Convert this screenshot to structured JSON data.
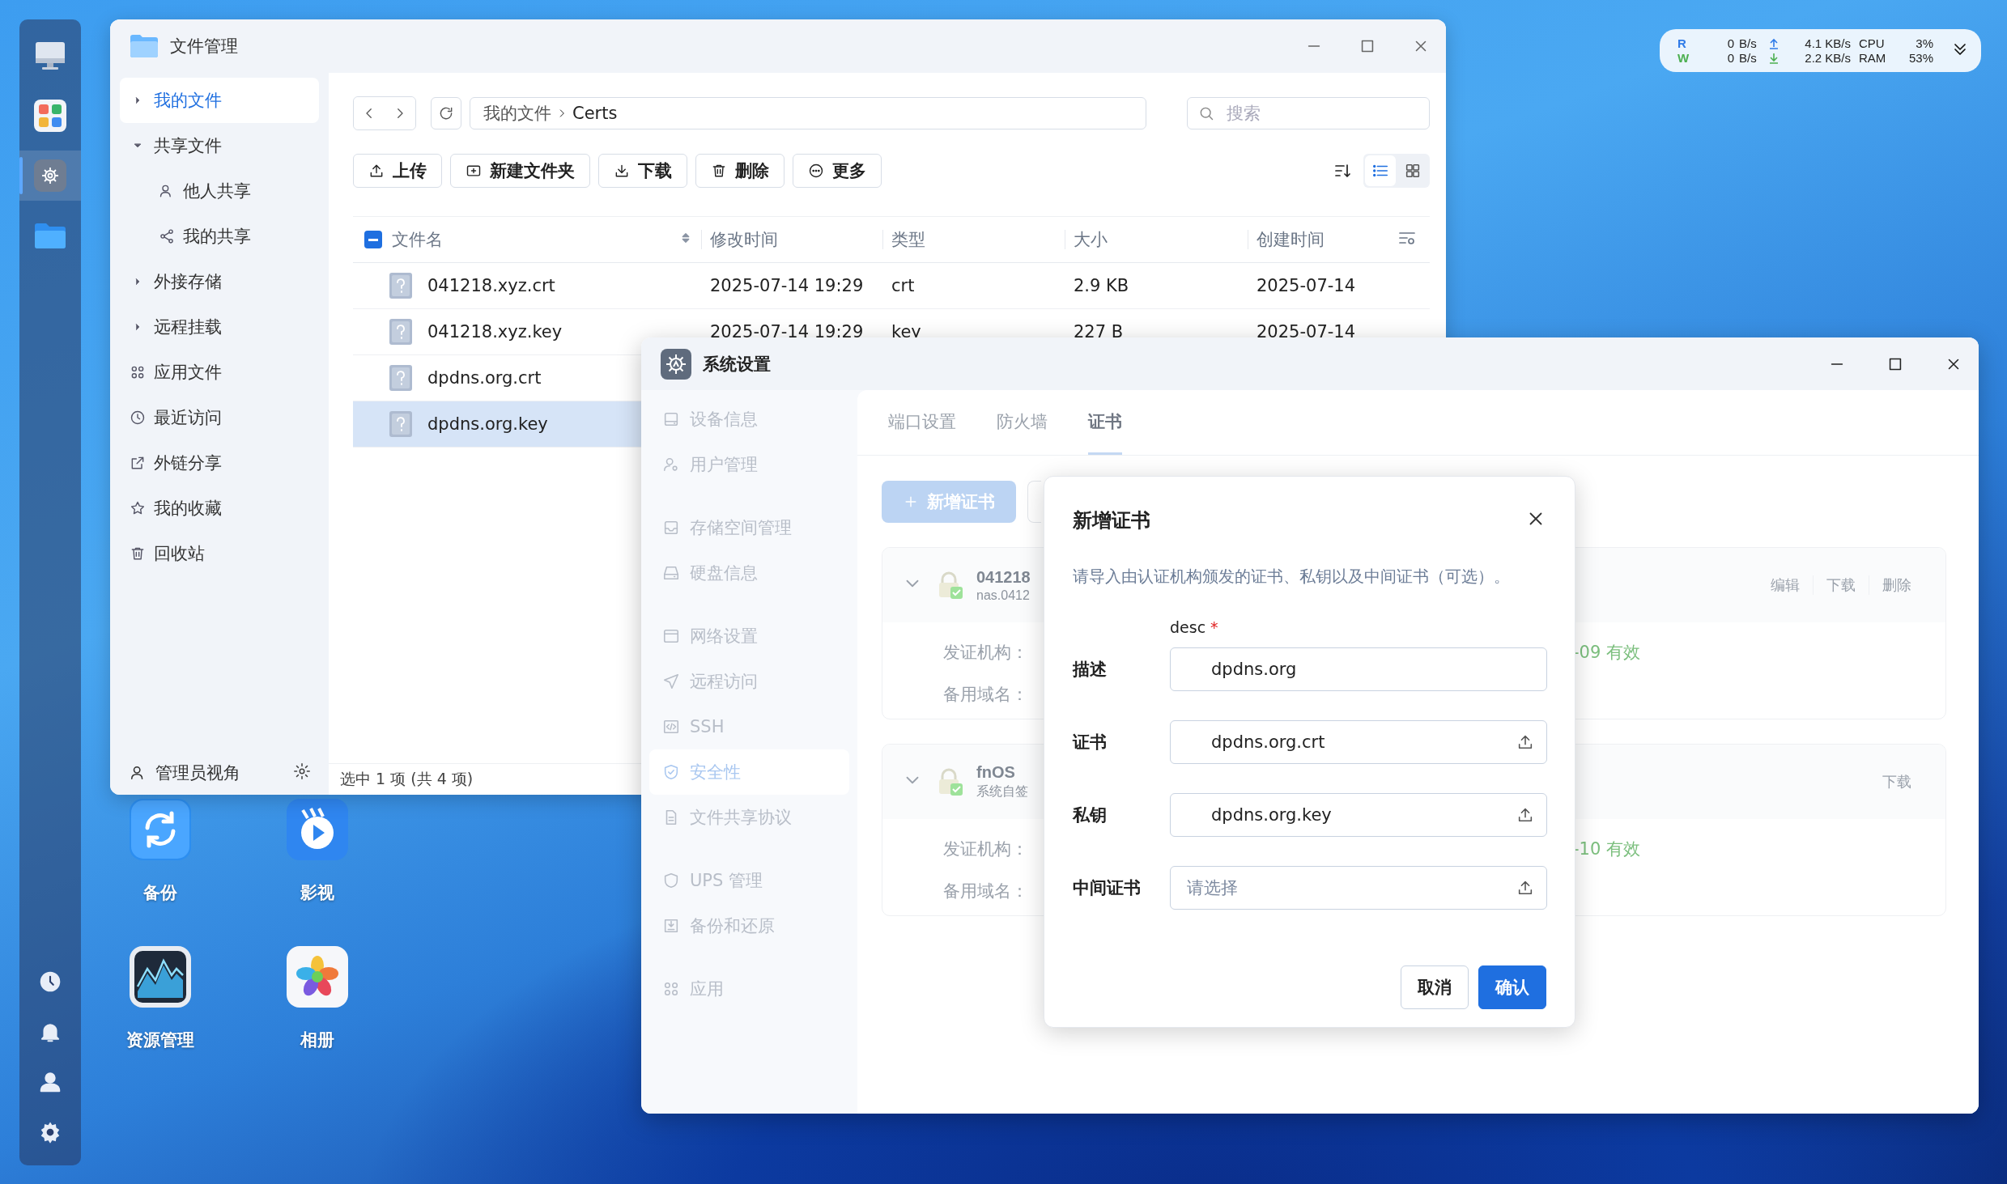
{
  "dock": {
    "items": [
      {
        "selected": false
      },
      {
        "selected": false
      },
      {
        "selected": true
      },
      {
        "selected": false
      }
    ],
    "bottom_items": [
      {
        "selected": false
      },
      {
        "selected": false
      },
      {
        "selected": false
      },
      {
        "selected": false
      }
    ]
  },
  "net_monitor": {
    "rows": [
      {
        "label": "R",
        "color": "#2f7be8",
        "rate": "0",
        "unit": "B/s",
        "speed": "4.1 KB/s",
        "metric": "CPU",
        "value": "3%"
      },
      {
        "label": "W",
        "color": "#4caf50",
        "rate": "0",
        "unit": "B/s",
        "speed": "2.2 KB/s",
        "metric": "RAM",
        "value": "53%"
      }
    ]
  },
  "desktop_icons": [
    {
      "label": "备份"
    },
    {
      "label": "影视"
    },
    {
      "label": "资源管理"
    },
    {
      "label": "相册"
    }
  ],
  "file_manager": {
    "title": "文件管理",
    "sidebar": {
      "items": [
        {
          "label": "我的文件",
          "selected": true,
          "expanded": false
        },
        {
          "label": "共享文件",
          "selected": false,
          "expanded": true,
          "children": [
            {
              "label": "他人共享",
              "selected": false
            },
            {
              "label": "我的共享",
              "selected": false
            }
          ]
        },
        {
          "label": "外接存储",
          "selected": false,
          "expanded": false
        },
        {
          "label": "远程挂载",
          "selected": false,
          "expanded": false
        },
        {
          "label": "应用文件",
          "selected": false
        },
        {
          "label": "最近访问",
          "selected": false
        },
        {
          "label": "外链分享",
          "selected": false
        },
        {
          "label": "我的收藏",
          "selected": false
        },
        {
          "label": "回收站",
          "selected": false
        }
      ]
    },
    "footer": {
      "label": "管理员视角"
    },
    "breadcrumb": [
      "我的文件",
      "Certs"
    ],
    "search": {
      "placeholder": "搜索"
    },
    "toolbar": [
      "上传",
      "新建文件夹",
      "下载",
      "删除",
      "更多"
    ],
    "view_buttons": [
      {
        "selected": true
      },
      {
        "selected": false
      }
    ],
    "table": {
      "select_all_partial": true,
      "columns": [
        "文件名",
        "修改时间",
        "类型",
        "大小",
        "创建时间"
      ],
      "rows": [
        {
          "selected": false,
          "cells": [
            "041218.xyz.crt",
            "2025-07-14 19:29",
            "crt",
            "2.9 KB",
            "2025-07-14"
          ]
        },
        {
          "selected": false,
          "cells": [
            "041218.xyz.key",
            "2025-07-14 19:29",
            "key",
            "227 B",
            "2025-07-14"
          ]
        },
        {
          "selected": false,
          "cells": [
            "dpdns.org.crt"
          ]
        },
        {
          "selected": true,
          "cells": [
            "dpdns.org.key"
          ]
        }
      ]
    },
    "status": "选中 1 项 (共 4 项)"
  },
  "settings": {
    "title": "系统设置",
    "sidebar": {
      "groups": [
        [
          {
            "label": "设备信息",
            "selected": false
          },
          {
            "label": "用户管理",
            "selected": false
          }
        ],
        [
          {
            "label": "存储空间管理",
            "selected": false
          },
          {
            "label": "硬盘信息",
            "selected": false
          }
        ],
        [
          {
            "label": "网络设置",
            "selected": false
          },
          {
            "label": "远程访问",
            "selected": false
          },
          {
            "label": "SSH",
            "selected": false
          },
          {
            "label": "安全性",
            "selected": true
          },
          {
            "label": "文件共享协议",
            "selected": false
          }
        ],
        [
          {
            "label": "UPS 管理",
            "selected": false
          },
          {
            "label": "备份和还原",
            "selected": false
          }
        ],
        [
          {
            "label": "应用",
            "selected": false
          }
        ]
      ]
    },
    "tabs": [
      {
        "label": "端口设置",
        "selected": false
      },
      {
        "label": "防火墙",
        "selected": false
      },
      {
        "label": "证书",
        "selected": true
      }
    ],
    "add_button": "新增证书",
    "certificates": [
      {
        "name": "041218",
        "subtitle": "nas.0412",
        "actions": [
          "编辑",
          "下载",
          "删除"
        ],
        "fields": [
          "发证机构：",
          "备用域名："
        ],
        "validity": "-09 有效"
      },
      {
        "name": "fnOS",
        "subtitle": "系统自签",
        "actions": [
          "下载"
        ],
        "fields": [
          "发证机构：",
          "备用域名："
        ],
        "validity": "-10 有效"
      }
    ]
  },
  "dialog": {
    "title": "新增证书",
    "description": "请导入由认证机构颁发的证书、私钥以及中间证书（可选）。",
    "fields": [
      {
        "kind": "text",
        "label": "描述",
        "hint": "desc",
        "hint_mark": "*",
        "value": "dpdns.org"
      },
      {
        "kind": "file",
        "label": "证书",
        "value": "dpdns.org.crt"
      },
      {
        "kind": "file",
        "label": "私钥",
        "value": "dpdns.org.key"
      },
      {
        "kind": "file",
        "label": "中间证书",
        "placeholder": "请选择"
      }
    ],
    "buttons": [
      {
        "kind": "secondary",
        "label": "取消"
      },
      {
        "kind": "primary",
        "label": "确认"
      }
    ]
  }
}
